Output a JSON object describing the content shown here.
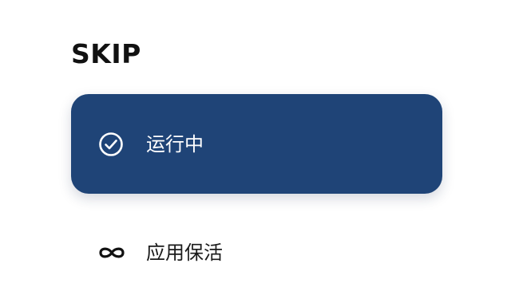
{
  "app": {
    "title": "SKIP"
  },
  "status_card": {
    "label": "运行中",
    "icon": "check-circle-icon",
    "background_color": "#1f4477",
    "text_color": "#ffffff"
  },
  "menu": {
    "items": [
      {
        "label": "应用保活",
        "icon": "infinity-icon"
      }
    ]
  }
}
